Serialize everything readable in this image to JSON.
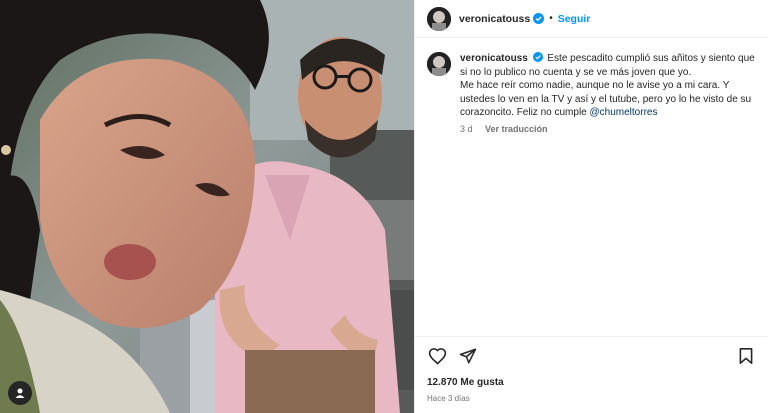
{
  "post": {
    "username": "veronicatouss",
    "follow_label": "Seguir",
    "dot": "•",
    "caption_username": "veronicatouss",
    "caption_line1": "Este pescadito cumplió sus añitos y siento que si no lo publico no cuenta y se ve más joven que yo.",
    "caption_line2": "Me hace reír como nadie, aunque no le avise yo a mi cara. Y ustedes lo ven en la TV y así y el tutube, pero yo lo he visto de su corazoncito. Feliz no cumple",
    "mention": "@chumeltorres",
    "comment_age": "3 d",
    "translate_label": "Ver traducción",
    "likes": "12.870 Me gusta",
    "time_ago": "Hace 3 días"
  },
  "icons": {
    "verified": "verified-badge-icon",
    "like": "heart-icon",
    "share": "paper-plane-icon",
    "save": "bookmark-icon",
    "tag": "user-tag-icon"
  },
  "colors": {
    "accent": "#0095f6",
    "verified": "#0095f6",
    "mention": "#00376b",
    "muted": "#737373"
  }
}
